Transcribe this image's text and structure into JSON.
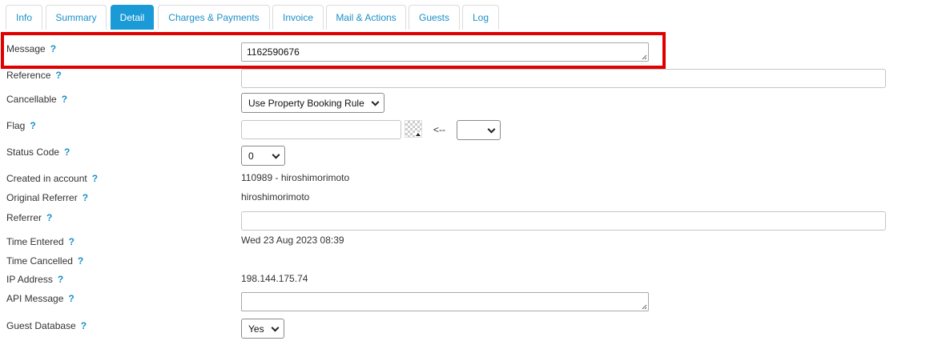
{
  "tabs": [
    {
      "label": "Info"
    },
    {
      "label": "Summary"
    },
    {
      "label": "Detail"
    },
    {
      "label": "Charges & Payments"
    },
    {
      "label": "Invoice"
    },
    {
      "label": "Mail & Actions"
    },
    {
      "label": "Guests"
    },
    {
      "label": "Log"
    }
  ],
  "active_tab": "Detail",
  "help_glyph": "?",
  "fields": {
    "message": {
      "label": "Message",
      "value": "1162590676"
    },
    "reference": {
      "label": "Reference",
      "value": ""
    },
    "cancellable": {
      "label": "Cancellable",
      "value": "Use Property Booking Rule"
    },
    "flag": {
      "label": "Flag",
      "value": "",
      "arrow_text": "<--",
      "select_value": ""
    },
    "status_code": {
      "label": "Status Code",
      "value": "0"
    },
    "created_in_account": {
      "label": "Created in account",
      "value": "110989 - hiroshimorimoto"
    },
    "original_referrer": {
      "label": "Original Referrer",
      "value": "hiroshimorimoto"
    },
    "referrer": {
      "label": "Referrer",
      "value": ""
    },
    "time_entered": {
      "label": "Time Entered",
      "value": "Wed 23 Aug 2023 08:39"
    },
    "time_cancelled": {
      "label": "Time Cancelled",
      "value": ""
    },
    "ip_address": {
      "label": "IP Address",
      "value": "198.144.175.74"
    },
    "api_message": {
      "label": "API Message",
      "value": ""
    },
    "guest_database": {
      "label": "Guest Database",
      "value": "Yes"
    }
  },
  "colors": {
    "accent": "#1a9ad6",
    "link": "#1a8fc9",
    "highlight": "#e00000"
  }
}
